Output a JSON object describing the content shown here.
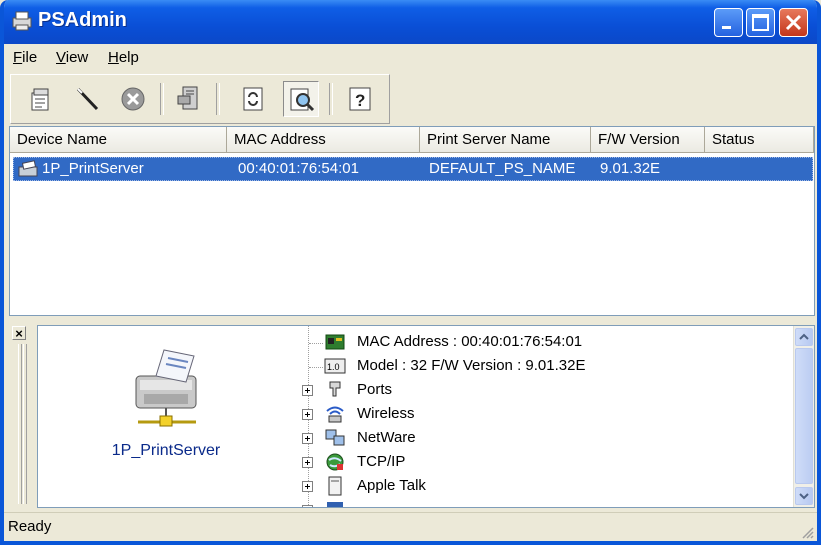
{
  "window": {
    "title": "PSAdmin"
  },
  "title_buttons": [
    "minimize",
    "maximize",
    "close"
  ],
  "menu": [
    {
      "label": "File"
    },
    {
      "label": "View"
    },
    {
      "label": "Help"
    }
  ],
  "toolbar": {
    "buttons": [
      "properties-icon",
      "wand-icon",
      "delete-icon",
      "printer-network-icon",
      "refresh-icon",
      "search-icon",
      "help-icon"
    ],
    "pressed": "search-icon"
  },
  "device_list": {
    "columns": [
      "Device Name",
      "MAC Address",
      "Print Server Name",
      "F/W Version",
      "Status"
    ],
    "rows": [
      {
        "device_name": "1P_PrintServer",
        "mac": "00:40:01:76:54:01",
        "print_server_name": "DEFAULT_PS_NAME",
        "fw_version": "9.01.32E",
        "status": ""
      }
    ]
  },
  "detail": {
    "close_label": "×",
    "device_label": "1P_PrintServer",
    "tree": [
      {
        "label": "MAC Address : 00:40:01:76:54:01",
        "expandable": false,
        "icon": "network-card-icon"
      },
      {
        "label": "Model : 32   F/W Version : 9.01.32E",
        "expandable": false,
        "icon": "version-icon"
      },
      {
        "label": "Ports",
        "expandable": true,
        "icon": "port-icon"
      },
      {
        "label": "Wireless",
        "expandable": true,
        "icon": "wireless-icon"
      },
      {
        "label": "NetWare",
        "expandable": true,
        "icon": "netware-icon"
      },
      {
        "label": "TCP/IP",
        "expandable": true,
        "icon": "tcpip-icon"
      },
      {
        "label": "Apple Talk",
        "expandable": true,
        "icon": "appletalk-icon"
      }
    ]
  },
  "status": {
    "text": "Ready"
  },
  "colors": {
    "title_bar": "#0a4fd6",
    "selection": "#316ac5",
    "window_bg": "#ece9d8"
  }
}
